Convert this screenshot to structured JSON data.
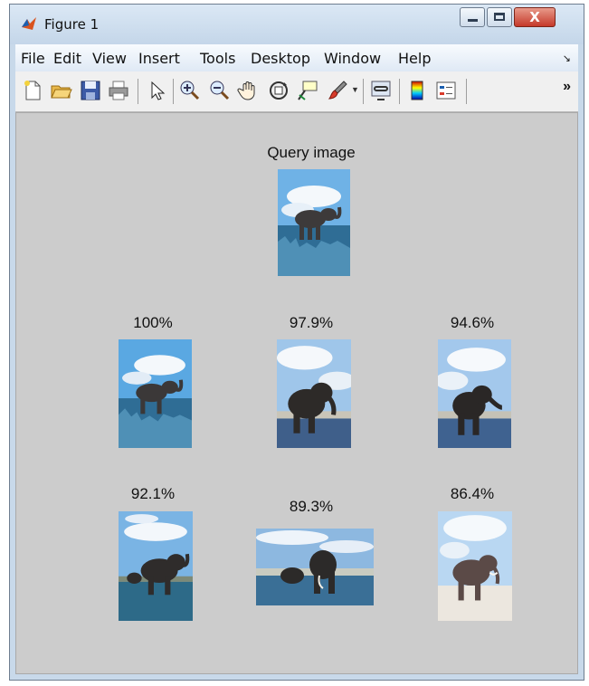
{
  "window": {
    "title": "Figure 1",
    "close_glyph": "X",
    "controls": [
      "minimize",
      "maximize",
      "close"
    ]
  },
  "menu": [
    "File",
    "Edit",
    "View",
    "Insert",
    "Tools",
    "Desktop",
    "Window",
    "Help"
  ],
  "toolbar": {
    "icons": [
      "new-figure-icon",
      "open-file-icon",
      "save-figure-icon",
      "print-figure-icon",
      "edit-plot-arrow-icon",
      "zoom-in-icon",
      "zoom-out-icon",
      "pan-hand-icon",
      "rotate-3d-icon",
      "data-cursor-icon",
      "brush-icon",
      "link-plot-icon",
      "colorbar-icon",
      "legend-icon"
    ],
    "overflow_glyph": "»"
  },
  "figure": {
    "query_label": "Query image",
    "results": [
      "100%",
      "97.9%",
      "94.6%",
      "92.1%",
      "89.3%",
      "86.4%"
    ]
  }
}
